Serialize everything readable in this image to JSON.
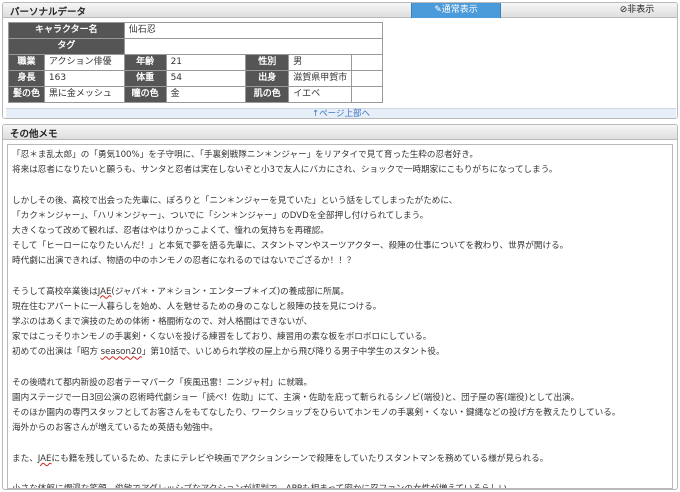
{
  "personal": {
    "title": "パーソナルデータ",
    "tab_normal": "✎通常表示",
    "tab_hide": "⊘非表示",
    "labels": {
      "name": "キャラクター名",
      "tag": "タグ",
      "job": "職業",
      "age": "年齢",
      "gender": "性別",
      "height": "身長",
      "weight": "体重",
      "origin": "出身",
      "hair": "髪の色",
      "eyes": "瞳の色",
      "skin": "肌の色"
    },
    "values": {
      "name": "仙石忍",
      "tag": "",
      "job": "アクション俳優",
      "age": "21",
      "gender": "男",
      "height": "163",
      "weight": "54",
      "origin": "滋賀県甲賀市",
      "hair": "黒に金メッシュ",
      "eyes": "金",
      "skin": "イエベ"
    },
    "top_link": "↑ページ上部へ"
  },
  "memo": {
    "title": "その他メモ",
    "lines": [
      {
        "text": "「忍＊ま乱太郎」の「勇気100%」を子守唄に、「手裏剣戦隊ニン＊ンジャー」をリアタイで見て育った生粋の忍者好き。"
      },
      {
        "text": "将来は忍者になりたいと願うも、サンタと忍者は実在しないぞと小3で友人にバカにされ、ショックで一時期家にこもりがちになってしまう。"
      },
      {
        "text": ""
      },
      {
        "text": "しかしその後、高校で出会った先輩に、ぽろりと「ニン＊ンジャーを見ていた」という話をしてしまったがために、"
      },
      {
        "text": "「カク＊ンジャー」、「ハリ＊ンジャー」、ついでに「シン＊ンジャー」のDVDを全部押し付けられてしまう。"
      },
      {
        "text": "大きくなって改めて観れば、忍者はやはりかっこよくて、憧れの気持ちを再確認。"
      },
      {
        "text": "そして「ヒーローになりたいんだ！」と本気で夢を語る先輩に、スタントマンやスーツアクター、殺陣の仕事についてを教わり、世界が開ける。"
      },
      {
        "text": "時代劇に出演できれば、物語の中のホンモノの忍者になれるのではないでござるか！！？"
      },
      {
        "text": ""
      },
      {
        "pre": "そうして高校卒業後は",
        "mark": "JAE",
        "post": "(ジャパ＊・ア＊ション・エンタープ＊イズ)の養成部に所属。"
      },
      {
        "text": "現在住むアパートに一人暮らしを始め、人を魅せるための身のこなしと殺陣の技を見につける。"
      },
      {
        "text": "学ぶのはあくまで演技のための体術・格闘術なので、対人格闘はできないが、"
      },
      {
        "text": "家ではこっそりホンモノの手裏剣・くないを投げる練習をしており、練習用の素な板をボロボロにしている。"
      },
      {
        "pre": "初めての出演は「昭方 ",
        "mark": "season20",
        "post": "」第10話で、いじめられ学校の屋上から飛び降りる男子中学生のスタント役。"
      },
      {
        "text": ""
      },
      {
        "text": "その後晴れて都内新設の忍者テーマパーク「疾風迅雷！ニンジャ村」に就職。"
      },
      {
        "text": "園内ステージで一日3回公演の忍術時代劇ショー「読べ！佐助」にて、主演・佐助を庇って斬られるシノビ(端役)と、団子屋の客(端役)として出演。"
      },
      {
        "text": "そのほか園内の専門スタッフとしてお客さんをもてなしたり、ワークショップをひらいてホンモノの手裏剣・くない・鍵縄などの投げ方を教えたりしている。"
      },
      {
        "text": "海外からのお客さんが増えているため英語も勉強中。"
      },
      {
        "text": ""
      },
      {
        "pre": "また、",
        "mark": "JAE",
        "post": "にも籍を残しているため、たまにテレビや映画でアクションシーンで殺陣をしていたりスタントマンを務めている様が見られる。"
      },
      {
        "text": ""
      },
      {
        "text": "小さな体躯に爛漫な笑顔、俊敏でアグレッシブなアクションが評判で、APPも相まって密かに忍ファンの女性が増えているらしい。"
      }
    ]
  }
}
